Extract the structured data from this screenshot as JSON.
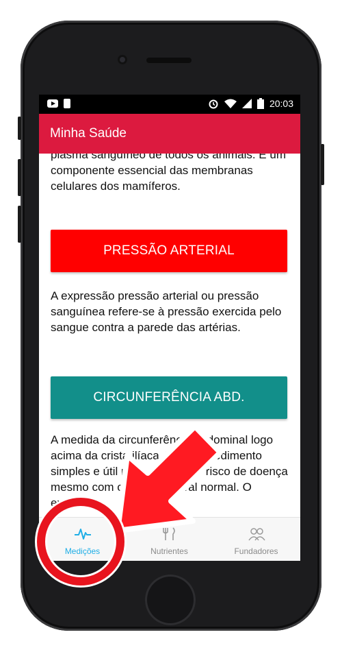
{
  "status": {
    "time": "20:03"
  },
  "app": {
    "title": "Minha Saúde"
  },
  "content": {
    "intro_text": "plasma sanguíneo de todos os animais. É um componente essencial das membranas celulares dos mamíferos.",
    "pressure_button": "PRESSÃO ARTERIAL",
    "pressure_text": "A expressão pressão arterial ou pressão sanguínea refere-se à pressão exercida pelo sangue contra a parede das artérias.",
    "waist_button": "CIRCUNFERÊNCIA ABD.",
    "waist_text": "A medida da circunferência abdominal logo acima da crista ilíaca é um procedimento simples e útil na avaliação do risco de doença mesmo com o peso corporal normal. O excesso"
  },
  "nav": {
    "items": [
      {
        "label": "Medições",
        "icon": "heartbeat-icon",
        "active": true
      },
      {
        "label": "Nutrientes",
        "icon": "cutlery-icon",
        "active": false
      },
      {
        "label": "Fundadores",
        "icon": "people-icon",
        "active": false
      }
    ]
  },
  "colors": {
    "appbar": "#dc1a3f",
    "pressure_button": "#ff0000",
    "waist_button": "#128f8a",
    "nav_active": "#1faee6",
    "annotation": "#e8141e"
  }
}
